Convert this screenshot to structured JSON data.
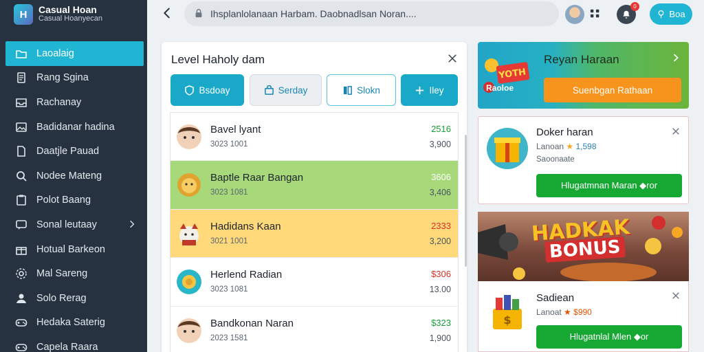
{
  "app": {
    "name": "Casual Hoan",
    "subtitle": "Casual Hoanyecan",
    "logo_letter": "H"
  },
  "sidebar": {
    "items": [
      {
        "label": "Laoalaig",
        "icon": "folder-icon",
        "active": true
      },
      {
        "label": "Rang Sgina",
        "icon": "document-icon"
      },
      {
        "label": "Rachanay",
        "icon": "inbox-icon"
      },
      {
        "label": "Badidanar hadina",
        "icon": "image-icon"
      },
      {
        "label": "Daatjle Pauad",
        "icon": "page-icon"
      },
      {
        "label": "Nodee Mateng",
        "icon": "search-icon"
      },
      {
        "label": "Polot Baang",
        "icon": "clipboard-icon"
      },
      {
        "label": "Sonal leutaay",
        "icon": "chat-icon",
        "has_chevron": true
      },
      {
        "label": "Hotual Barkeon",
        "icon": "gift-icon"
      },
      {
        "label": "Mal Sareng",
        "icon": "settings-icon"
      },
      {
        "label": "Solo Rerag",
        "icon": "user-icon"
      },
      {
        "label": "Hedaka Saterig",
        "icon": "gamepad-icon"
      },
      {
        "label": "Capela Raara",
        "icon": "gamepad-icon"
      }
    ]
  },
  "topbar": {
    "search_text": "Ihsplanlolanaan Harbam. Daobnadlsan Noran....",
    "notification_count": "0",
    "action_label": "Boa"
  },
  "panel": {
    "title": "Level  Haholy dam",
    "tabs": [
      {
        "label": "Bsdoay",
        "icon": "shield-icon"
      },
      {
        "label": "Serday",
        "icon": "bag-icon"
      },
      {
        "label": "Slokn",
        "icon": "book-icon"
      },
      {
        "label": "Iley",
        "icon": "plus-icon"
      }
    ],
    "rows": [
      {
        "name": "Bavel lyant",
        "sub": "3023 1001",
        "v1": "2516",
        "v2": "3,900",
        "v1_color": "#1a9e3a",
        "bg": "white",
        "avatar": "boy-avatar"
      },
      {
        "name": "Baptle Raar Bangan",
        "sub": "3023 1081",
        "v1": "3606",
        "v2": "3,406",
        "v1_color": "#ffffff",
        "bg": "green",
        "avatar": "lion-avatar"
      },
      {
        "name": "Hadidans Kaan",
        "sub": "3021 1001",
        "v1": "2333",
        "v2": "3,200",
        "v1_color": "#d93025",
        "bg": "yellow",
        "avatar": "cat-avatar"
      },
      {
        "name": "Herlend Radian",
        "sub": "3023 1081",
        "v1": "$306",
        "v2": "13.00",
        "v1_color": "#d93025",
        "bg": "white",
        "avatar": "coin-avatar"
      },
      {
        "name": "Bandkonan Naran",
        "sub": "2023 1581",
        "v1": "$323",
        "v2": "1,900",
        "v1_color": "#1a9e3a",
        "bg": "white",
        "avatar": "boy-avatar"
      }
    ]
  },
  "promo": {
    "title": "Reyan Haraan",
    "button": "Suenbgan Rathaan",
    "badge_text": "Raoloe",
    "art_text": "YOTH"
  },
  "cards": [
    {
      "title": "Doker haran",
      "rating_prefix": "Lanoan",
      "rating": "1,598",
      "sub": "Saoonaate",
      "button": "Hlugatmnan Maran ◆ror"
    },
    {
      "title": "Sadiean",
      "rating_prefix": "Lanoat",
      "rating": "$990",
      "sub": "",
      "button": "Hlugatnlal Mlen ◆or"
    }
  ],
  "banner": {
    "line1": "HADKAK",
    "line2": "BONUS"
  },
  "colors": {
    "sidebar_bg": "#263240",
    "accent": "#1fb5d3",
    "green_row": "#a7d97a",
    "yellow_row": "#ffd97a",
    "cta_green": "#17a834",
    "cta_orange": "#f7941d"
  }
}
